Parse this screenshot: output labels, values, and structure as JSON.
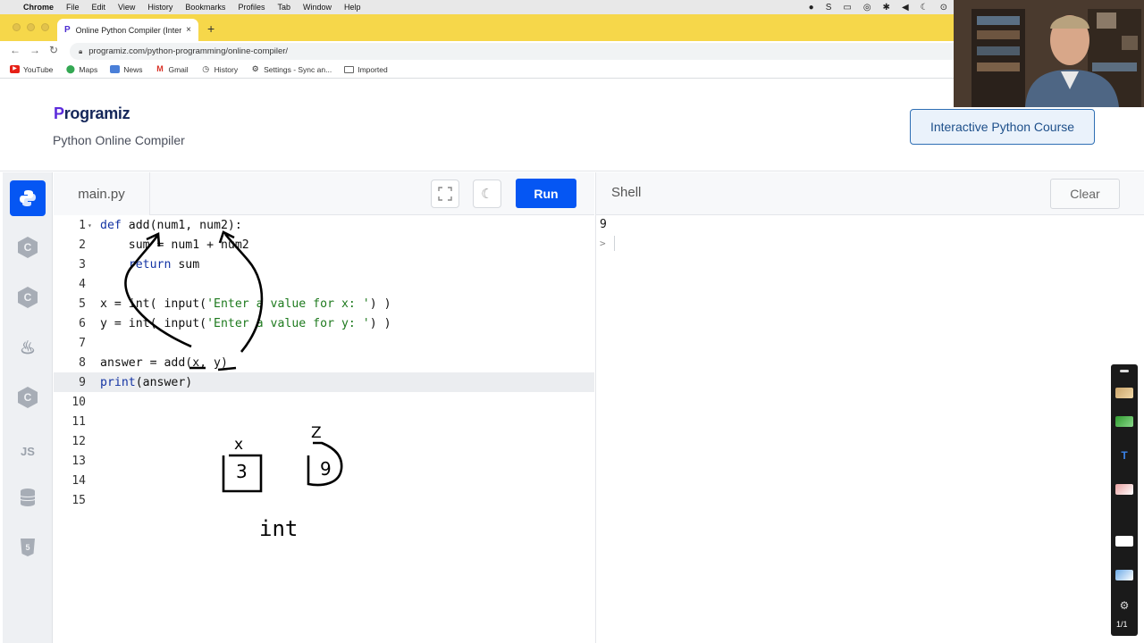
{
  "menubar": {
    "items": [
      "Chrome",
      "File",
      "Edit",
      "View",
      "History",
      "Bookmarks",
      "Profiles",
      "Tab",
      "Window",
      "Help"
    ]
  },
  "browser": {
    "tab_title": "Online Python Compiler (Interp",
    "url": "programiz.com/python-programming/online-compiler/",
    "bookmarks": [
      {
        "label": "YouTube",
        "icon": "youtube-icon"
      },
      {
        "label": "Maps",
        "icon": "maps-icon"
      },
      {
        "label": "News",
        "icon": "news-icon"
      },
      {
        "label": "Gmail",
        "icon": "gmail-icon"
      },
      {
        "label": "History",
        "icon": "history-icon"
      },
      {
        "label": "Settings - Sync an...",
        "icon": "gear-icon"
      },
      {
        "label": "Imported",
        "icon": "folder-icon"
      }
    ]
  },
  "header": {
    "logo": "rogramiz",
    "logo_mark": "P",
    "subtitle": "Python Online Compiler",
    "course_button": "Interactive Python Course"
  },
  "sidebar": {
    "items": [
      "python-icon",
      "c-icon",
      "cpp-icon",
      "java-icon",
      "csharp-icon",
      "js-icon",
      "database-icon",
      "html5-icon"
    ],
    "js_label": "JS"
  },
  "editor": {
    "filename": "main.py",
    "run_label": "Run",
    "active_line": 9,
    "lines": [
      {
        "n": "1",
        "text": "def add(num1, num2):"
      },
      {
        "n": "2",
        "text": "    sum = num1 + num2"
      },
      {
        "n": "3",
        "text": "    return sum"
      },
      {
        "n": "4",
        "text": ""
      },
      {
        "n": "5",
        "text": "x = int( input('Enter a value for x: ') )"
      },
      {
        "n": "6",
        "text": "y = int( input('Enter a value for y: ') )"
      },
      {
        "n": "7",
        "text": ""
      },
      {
        "n": "8",
        "text": "answer = add(x, y)"
      },
      {
        "n": "9",
        "text": "print(answer)"
      },
      {
        "n": "10",
        "text": ""
      },
      {
        "n": "11",
        "text": ""
      },
      {
        "n": "12",
        "text": ""
      },
      {
        "n": "13",
        "text": ""
      },
      {
        "n": "14",
        "text": ""
      },
      {
        "n": "15",
        "text": ""
      }
    ]
  },
  "handwriting": {
    "box1_label": "x",
    "box1_value": "3",
    "box2_label": "Z",
    "box2_value": "9",
    "type_note": "int"
  },
  "shell": {
    "title": "Shell",
    "clear_label": "Clear",
    "output": "9",
    "prompt": ">"
  },
  "palette": {
    "page_indicator": "1/1"
  }
}
